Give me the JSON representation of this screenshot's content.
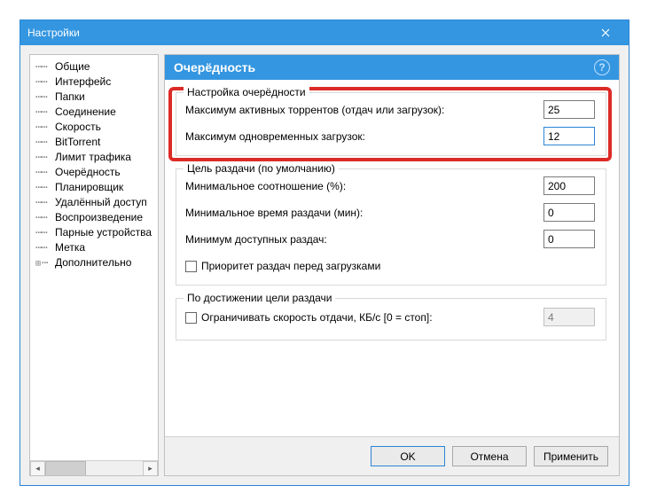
{
  "window": {
    "title": "Настройки"
  },
  "sidebar": {
    "items": [
      {
        "label": "Общие"
      },
      {
        "label": "Интерфейс"
      },
      {
        "label": "Папки"
      },
      {
        "label": "Соединение"
      },
      {
        "label": "Скорость"
      },
      {
        "label": "BitTorrent"
      },
      {
        "label": "Лимит трафика"
      },
      {
        "label": "Очерёдность"
      },
      {
        "label": "Планировщик"
      },
      {
        "label": "Удалённый доступ"
      },
      {
        "label": "Воспроизведение"
      },
      {
        "label": "Парные устройства"
      },
      {
        "label": "Метка"
      },
      {
        "label": "Дополнительно"
      }
    ]
  },
  "content": {
    "title": "Очерёдность",
    "group_queue": {
      "title": "Настройка очерёдности",
      "max_active_label": "Максимум активных торрентов (отдач или загрузок):",
      "max_active_value": "25",
      "max_downloads_label": "Максимум одновременных загрузок:",
      "max_downloads_value": "12"
    },
    "group_seed": {
      "title": "Цель раздачи (по умолчанию)",
      "ratio_label": "Минимальное соотношение (%):",
      "ratio_value": "200",
      "time_label": "Минимальное время раздачи (мин):",
      "time_value": "0",
      "avail_label": "Минимум доступных раздач:",
      "avail_value": "0",
      "priority_label": "Приоритет раздач перед загрузками"
    },
    "group_reach": {
      "title": "По достижении цели раздачи",
      "limit_label": "Ограничивать скорость отдачи, КБ/с [0 = стоп]:",
      "limit_value": "4"
    }
  },
  "buttons": {
    "ok": "OK",
    "cancel": "Отмена",
    "apply": "Применить"
  }
}
